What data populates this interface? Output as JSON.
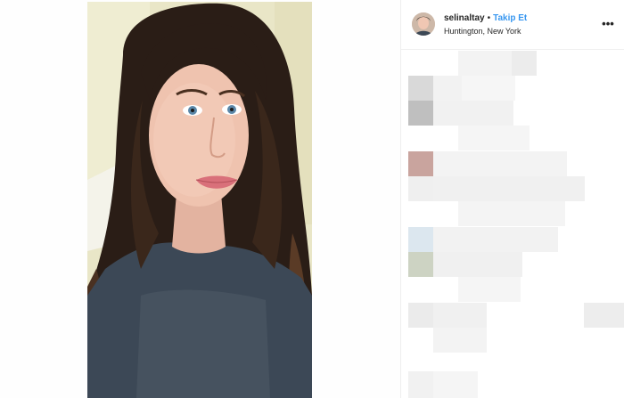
{
  "post": {
    "username": "selinaltay",
    "separator": "•",
    "follow_label": "Takip Et",
    "location": "Huntington, New York",
    "more_icon": "more-dots-icon"
  },
  "photo": {
    "subject": "selfie-photo"
  }
}
